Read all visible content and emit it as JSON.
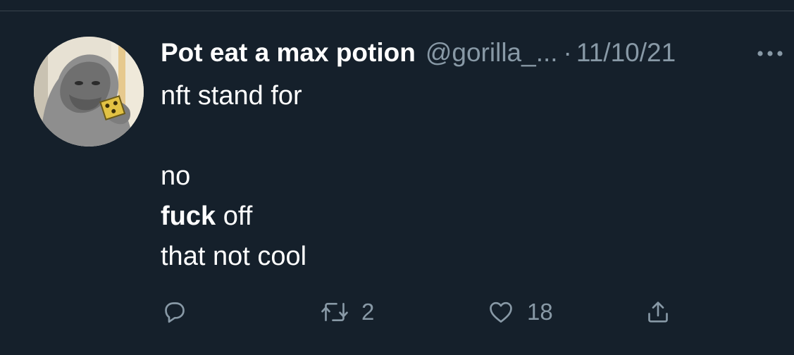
{
  "tweet": {
    "display_name": "Pot eat a max potion",
    "handle": "@gorilla_...",
    "separator": "·",
    "timestamp": "11/10/21",
    "more_icon": "more-horizontal-icon",
    "text_lines": {
      "line1": "nft stand for",
      "line2": "no",
      "line3_bold": "fuck",
      "line3_rest": " off",
      "line4": "that not cool"
    },
    "actions": {
      "reply": {
        "icon": "reply-bubble-icon",
        "count": ""
      },
      "retweet": {
        "icon": "retweet-icon",
        "count": "2"
      },
      "like": {
        "icon": "heart-icon",
        "count": "18"
      },
      "share": {
        "icon": "share-upload-icon",
        "count": ""
      }
    }
  },
  "colors": {
    "background": "#15202b",
    "text_primary": "#ffffff",
    "text_secondary": "#8899a6",
    "divider": "#38444d"
  }
}
